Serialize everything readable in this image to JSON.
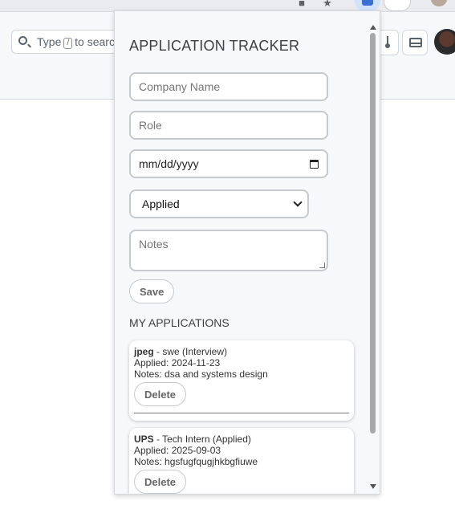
{
  "browser": {
    "icons": [
      "extension-icon",
      "star-icon",
      "pinned-extension-icon",
      "profile-icon"
    ]
  },
  "page_header": {
    "search": {
      "prefix": "Type",
      "key": "/",
      "suffix": "to search"
    }
  },
  "popup": {
    "title": "APPLICATION TRACKER",
    "form": {
      "company_placeholder": "Company Name",
      "role_placeholder": "Role",
      "date_value": "mm/dd/yyyy",
      "status_selected": "Applied",
      "notes_placeholder": "Notes",
      "save_label": "Save"
    },
    "list_title": "MY APPLICATIONS",
    "applications": [
      {
        "company": "jpeg",
        "summary": " - swe (Interview)",
        "applied": "Applied: 2024-11-23",
        "notes": "Notes: dsa and systems design",
        "delete_label": "Delete"
      },
      {
        "company": "UPS",
        "summary": " - Tech Intern (Applied)",
        "applied": "Applied: 2025-09-03",
        "notes": "Notes: hgsfugfqugjhkbgfiuwe",
        "delete_label": "Delete"
      }
    ]
  },
  "colors": {
    "popup_bg": "#f7f8fa",
    "field_border": "#c6cacf",
    "button_text": "#666666",
    "header_bg": "#f6f8fa"
  }
}
